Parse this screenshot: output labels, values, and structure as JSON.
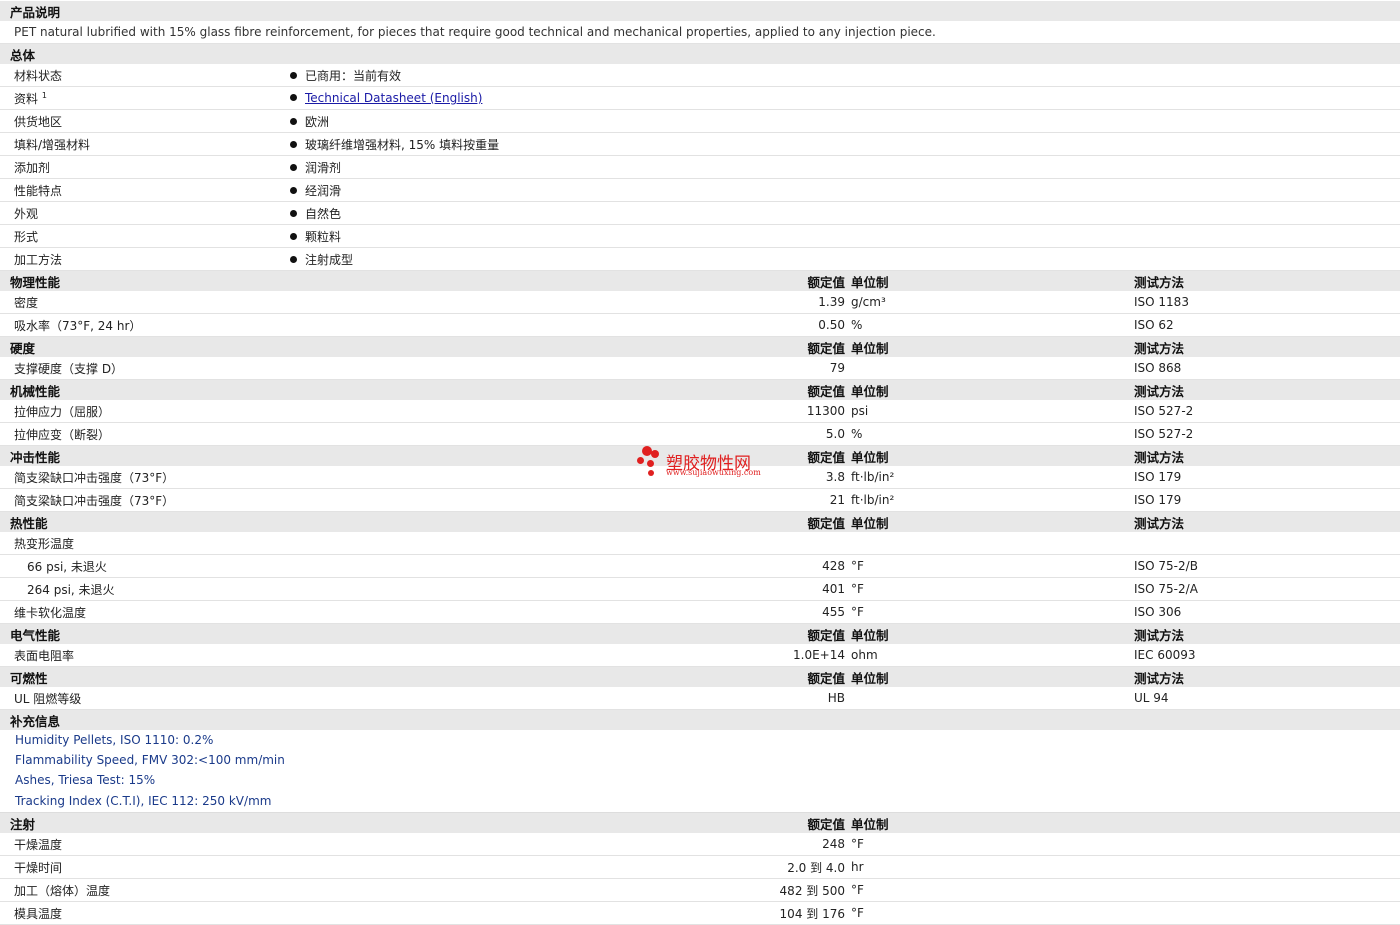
{
  "description": {
    "title": "产品说明",
    "text": "PET natural lubrified with 15% glass fibre reinforcement, for pieces that require good technical and mechanical properties, applied to any injection piece."
  },
  "general": {
    "title": "总体",
    "rows": [
      {
        "label": "材料状态",
        "value": "已商用：当前有效"
      },
      {
        "label": "资料",
        "sup": "1",
        "value": "Technical Datasheet (English)"
      },
      {
        "label": "供货地区",
        "value": "欧洲"
      },
      {
        "label": "填料/增强材料",
        "value": "玻璃纤维增强材料, 15% 填料按重量"
      },
      {
        "label": "添加剂",
        "value": "润滑剂"
      },
      {
        "label": "性能特点",
        "value": "经润滑"
      },
      {
        "label": "外观",
        "value": "自然色"
      },
      {
        "label": "形式",
        "value": "颗粒料"
      },
      {
        "label": "加工方法",
        "value": "注射成型"
      }
    ]
  },
  "col_headers": {
    "value": "额定值",
    "unit": "单位制",
    "method": "测试方法"
  },
  "physical": {
    "title": "物理性能",
    "rows": [
      {
        "label": "密度",
        "value": "1.39",
        "unit": "g/cm³",
        "method": "ISO 1183"
      },
      {
        "label": "吸水率（73°F, 24 hr）",
        "value": "0.50",
        "unit": "%",
        "method": "ISO 62"
      }
    ]
  },
  "hardness": {
    "title": "硬度",
    "rows": [
      {
        "label": "支撑硬度（支撑 D）",
        "value": "79",
        "unit": "",
        "method": "ISO 868"
      }
    ]
  },
  "mechanical": {
    "title": "机械性能",
    "rows": [
      {
        "label": "拉伸应力（屈服）",
        "value": "11300",
        "unit": "psi",
        "method": "ISO 527-2"
      },
      {
        "label": "拉伸应变（断裂）",
        "value": "5.0",
        "unit": "%",
        "method": "ISO 527-2"
      }
    ]
  },
  "impact": {
    "title": "冲击性能",
    "rows": [
      {
        "label": "简支梁缺口冲击强度（73°F）",
        "value": "3.8",
        "unit": "ft·lb/in²",
        "method": "ISO 179"
      },
      {
        "label": "简支梁缺口冲击强度（73°F）",
        "value": "21",
        "unit": "ft·lb/in²",
        "method": "ISO 179"
      }
    ]
  },
  "thermal": {
    "title": "热性能",
    "rows": [
      {
        "label": "热变形温度",
        "value": "",
        "unit": "",
        "method": ""
      },
      {
        "label": "66 psi, 未退火",
        "value": "428",
        "unit": "°F",
        "method": "ISO 75-2/B"
      },
      {
        "label": "264 psi, 未退火",
        "value": "401",
        "unit": "°F",
        "method": "ISO 75-2/A"
      },
      {
        "label": "维卡软化温度",
        "value": "455",
        "unit": "°F",
        "method": "ISO 306"
      }
    ]
  },
  "electrical": {
    "title": "电气性能",
    "rows": [
      {
        "label": "表面电阻率",
        "value": "1.0E+14",
        "unit": "ohm",
        "method": "IEC 60093"
      }
    ]
  },
  "flammability": {
    "title": "可燃性",
    "rows": [
      {
        "label": "UL 阻燃等级",
        "value": "HB",
        "unit": "",
        "method": "UL 94"
      }
    ]
  },
  "supplement": {
    "title": "补充信息",
    "notes": [
      "Humidity Pellets, ISO 1110: 0.2%",
      "Flammability Speed, FMV 302:<100 mm/min",
      "Ashes, Triesa Test: 15%",
      "Tracking Index (C.T.I), IEC 112: 250 kV/mm"
    ]
  },
  "injection": {
    "title": "注射",
    "rows": [
      {
        "label": "干燥温度",
        "value": "248",
        "unit": "°F"
      },
      {
        "label": "干燥时间",
        "value": "2.0 到  4.0",
        "unit": "hr"
      },
      {
        "label": "加工（熔体）温度",
        "value": "482 到  500",
        "unit": "°F"
      },
      {
        "label": "模具温度",
        "value": "104 到  176",
        "unit": "°F"
      }
    ]
  },
  "watermark": {
    "title": "塑胶物性网",
    "url": "www.sujiaowuxing.com"
  }
}
